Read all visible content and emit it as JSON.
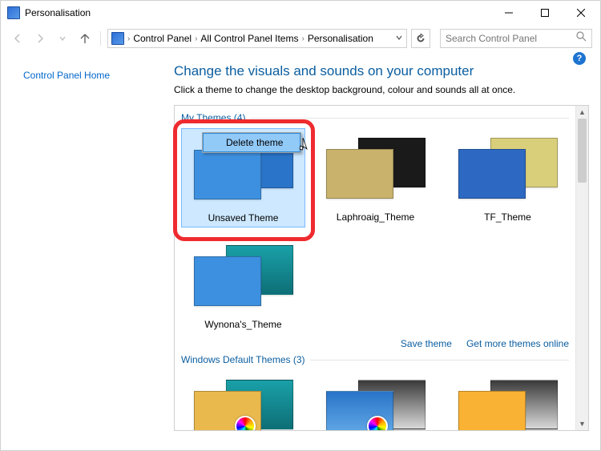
{
  "window": {
    "title": "Personalisation"
  },
  "breadcrumbs": {
    "b1": "Control Panel",
    "b2": "All Control Panel Items",
    "b3": "Personalisation"
  },
  "search": {
    "placeholder": "Search Control Panel"
  },
  "sidebar": {
    "home": "Control Panel Home"
  },
  "main": {
    "heading": "Change the visuals and sounds on your computer",
    "subtext": "Click a theme to change the desktop background, colour and sounds all at once."
  },
  "sections": {
    "my_themes": {
      "label": "My Themes (4)"
    },
    "default_themes": {
      "label": "Windows Default Themes (3)"
    }
  },
  "themes": {
    "t1": "Unsaved Theme",
    "t2": "Laphroaig_Theme",
    "t3": "TF_Theme",
    "t4": "Wynona's_Theme"
  },
  "links": {
    "save": "Save theme",
    "more": "Get more themes online"
  },
  "context_menu": {
    "delete": "Delete theme"
  },
  "help": {
    "char": "?"
  }
}
